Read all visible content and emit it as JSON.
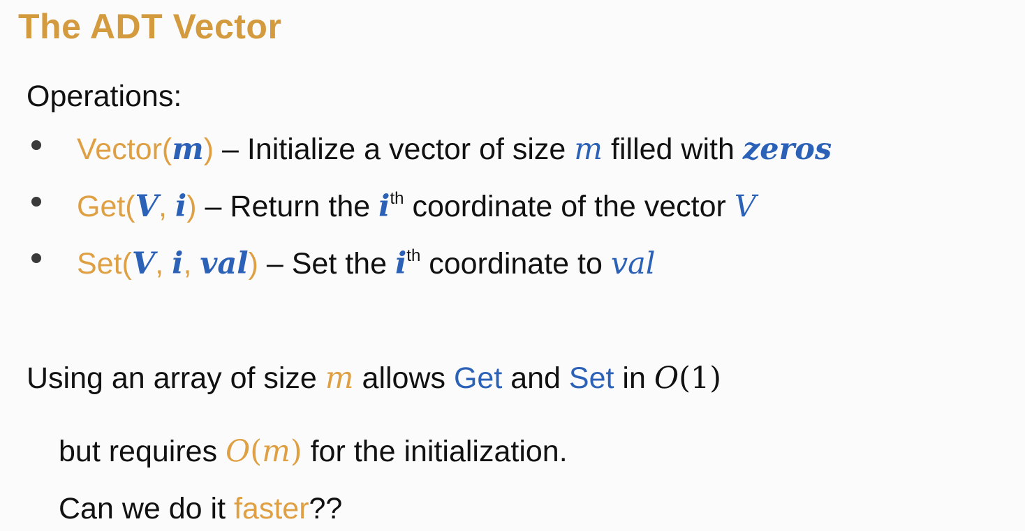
{
  "colors": {
    "title": "#d49a3e",
    "orange": "#df9f43",
    "blue": "#2b62b8",
    "text": "#111111",
    "background": "#fbfbfb"
  },
  "title": "The ADT Vector",
  "operations_heading": "Operations:",
  "operations": [
    {
      "name": "Vector(",
      "args": [
        {
          "text": "m",
          "sep": ""
        }
      ],
      "close": ")",
      "dash": " – Initialize a vector of size ",
      "var1": "m",
      "mid": " filled with ",
      "var2": "zeros"
    },
    {
      "name": "Get(",
      "args": [
        {
          "text": "V",
          "sep": ", "
        },
        {
          "text": "i",
          "sep": ""
        }
      ],
      "close": ")",
      "dash": " – Return the ",
      "ivar": "i",
      "sup": "th",
      "rest": " coordinate of the vector ",
      "var1": "V"
    },
    {
      "name": "Set(",
      "args": [
        {
          "text": "V",
          "sep": ", "
        },
        {
          "text": "i",
          "sep": ", "
        },
        {
          "text": "val",
          "sep": ""
        }
      ],
      "close": ")",
      "dash": " – Set the ",
      "ivar": "i",
      "sup": "th",
      "rest": " coordinate to ",
      "var1": "val"
    }
  ],
  "array_line": {
    "t1": "Using an array of size ",
    "m": "m",
    "t2": " allows ",
    "get": "Get",
    "t3": " and ",
    "set": "Set",
    "t4": " in ",
    "o1": "O",
    "o2": "(1)"
  },
  "init_line": {
    "t1": "but requires ",
    "o": "O",
    "paren_open": "(",
    "m": "m",
    "paren_close": ")",
    "t2": " for the initialization."
  },
  "faster_line": {
    "t1": "Can we do it ",
    "faster": "faster",
    "t2": "??"
  }
}
